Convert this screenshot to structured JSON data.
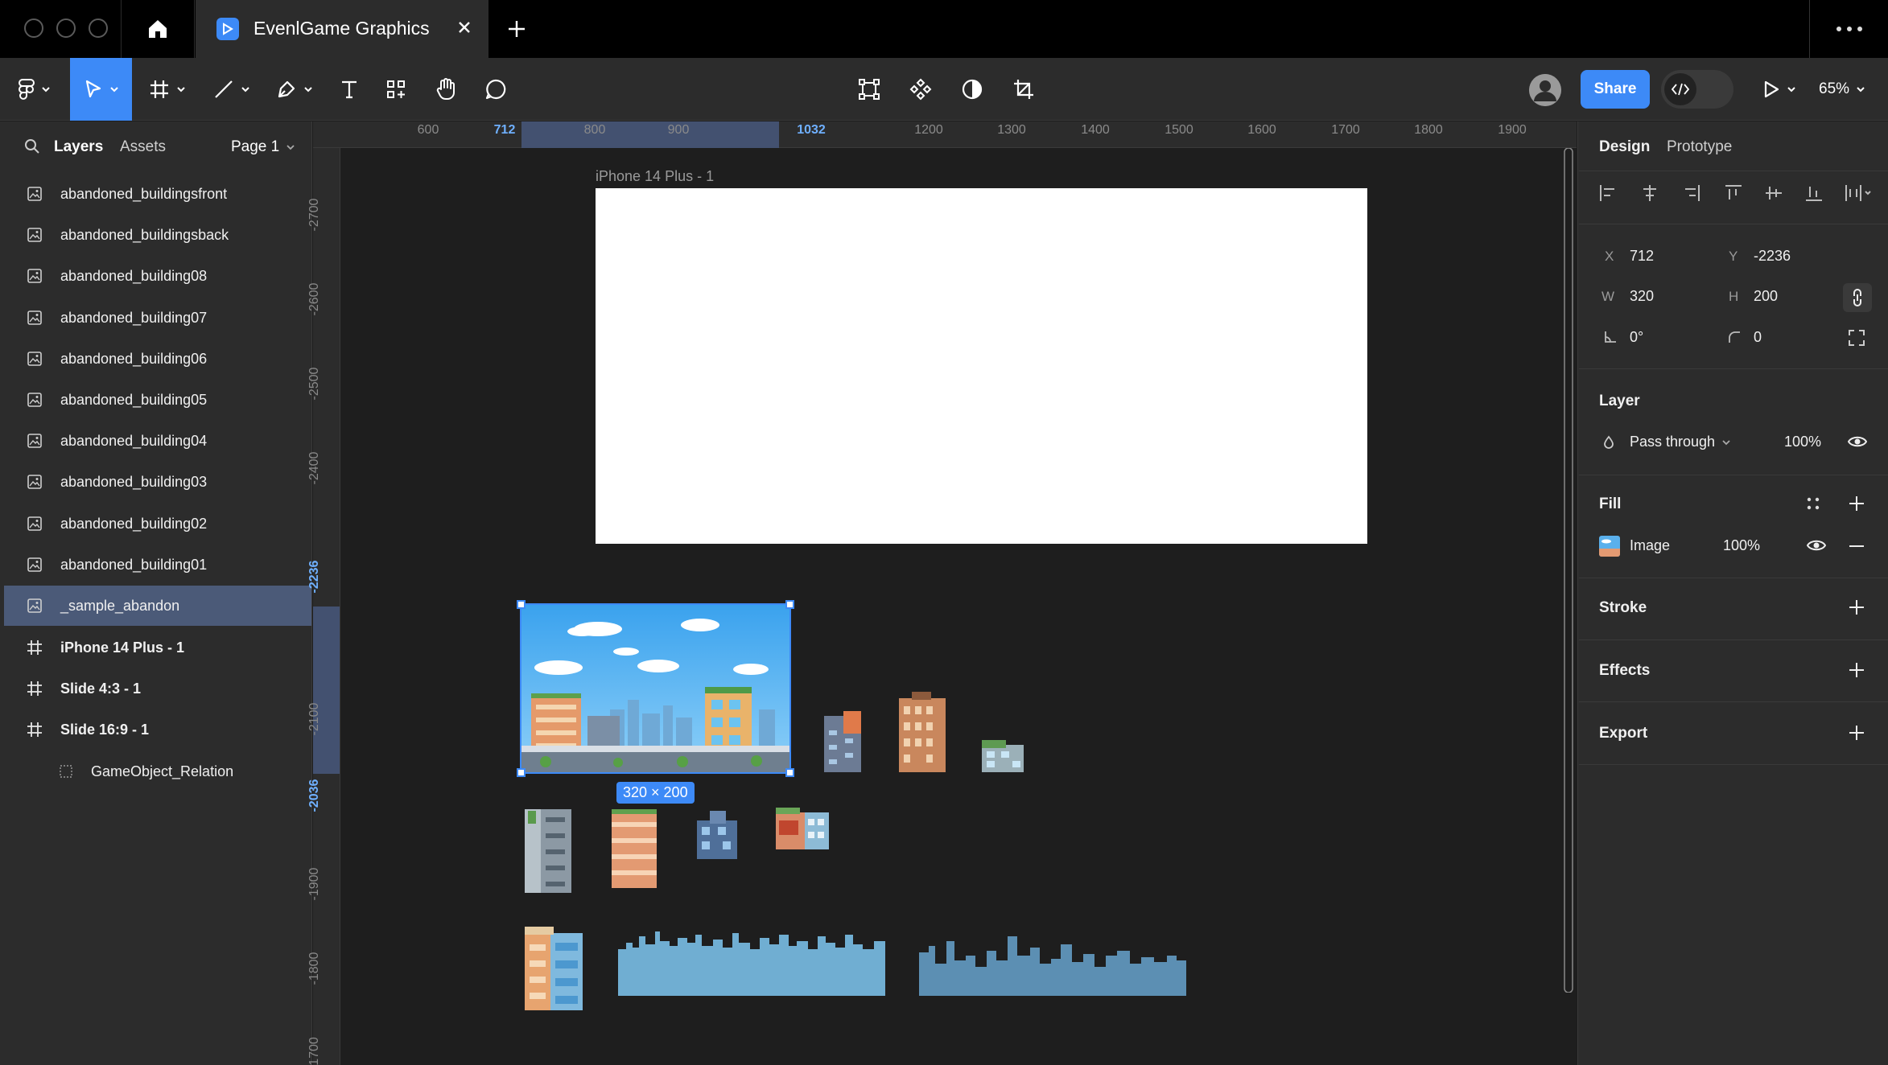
{
  "titlebar": {
    "file_title": "EvenlGame Graphics"
  },
  "toolbar": {
    "share_label": "Share",
    "zoom_label": "65%"
  },
  "left_panel": {
    "tabs": [
      "Layers",
      "Assets"
    ],
    "page_selector": "Page 1",
    "layers": [
      {
        "name": "abandoned_buildingsfront",
        "type": "image"
      },
      {
        "name": "abandoned_buildingsback",
        "type": "image"
      },
      {
        "name": "abandoned_building08",
        "type": "image"
      },
      {
        "name": "abandoned_building07",
        "type": "image"
      },
      {
        "name": "abandoned_building06",
        "type": "image"
      },
      {
        "name": "abandoned_building05",
        "type": "image"
      },
      {
        "name": "abandoned_building04",
        "type": "image"
      },
      {
        "name": "abandoned_building03",
        "type": "image"
      },
      {
        "name": "abandoned_building02",
        "type": "image"
      },
      {
        "name": "abandoned_building01",
        "type": "image"
      },
      {
        "name": "_sample_abandon",
        "type": "image",
        "selected": true
      },
      {
        "name": "iPhone 14 Plus - 1",
        "type": "frame"
      },
      {
        "name": "Slide 4:3 - 1",
        "type": "frame"
      },
      {
        "name": "Slide 16:9 - 1",
        "type": "frame"
      },
      {
        "name": "GameObject_Relation",
        "type": "section-child"
      }
    ]
  },
  "rulers": {
    "top_ticks": [
      "600",
      "712",
      "800",
      "900",
      "1032",
      "1200",
      "1300",
      "1400",
      "1500",
      "1600",
      "1700",
      "1800",
      "1900"
    ],
    "left_ticks": [
      "-2700",
      "-2600",
      "-2500",
      "-2400",
      "-2236",
      "-2100",
      "-2036",
      "-1900",
      "-1800",
      "1700"
    ]
  },
  "canvas": {
    "frame_label": "iPhone 14 Plus - 1",
    "selection_size": "320 × 200"
  },
  "right_panel": {
    "tabs": [
      "Design",
      "Prototype"
    ],
    "x_label": "X",
    "x_value": "712",
    "y_label": "Y",
    "y_value": "-2236",
    "w_label": "W",
    "w_value": "320",
    "h_label": "H",
    "h_value": "200",
    "rotation_value": "0°",
    "radius_value": "0",
    "layer_title": "Layer",
    "blend_mode": "Pass through",
    "layer_opacity": "100%",
    "fill_title": "Fill",
    "fill_type": "Image",
    "fill_opacity": "100%",
    "stroke_title": "Stroke",
    "effects_title": "Effects",
    "export_title": "Export"
  },
  "colors": {
    "accent": "#3d8af7",
    "panel": "#2c2c2c",
    "canvas": "#1e1e1e",
    "selected_row": "#4b5a78"
  }
}
